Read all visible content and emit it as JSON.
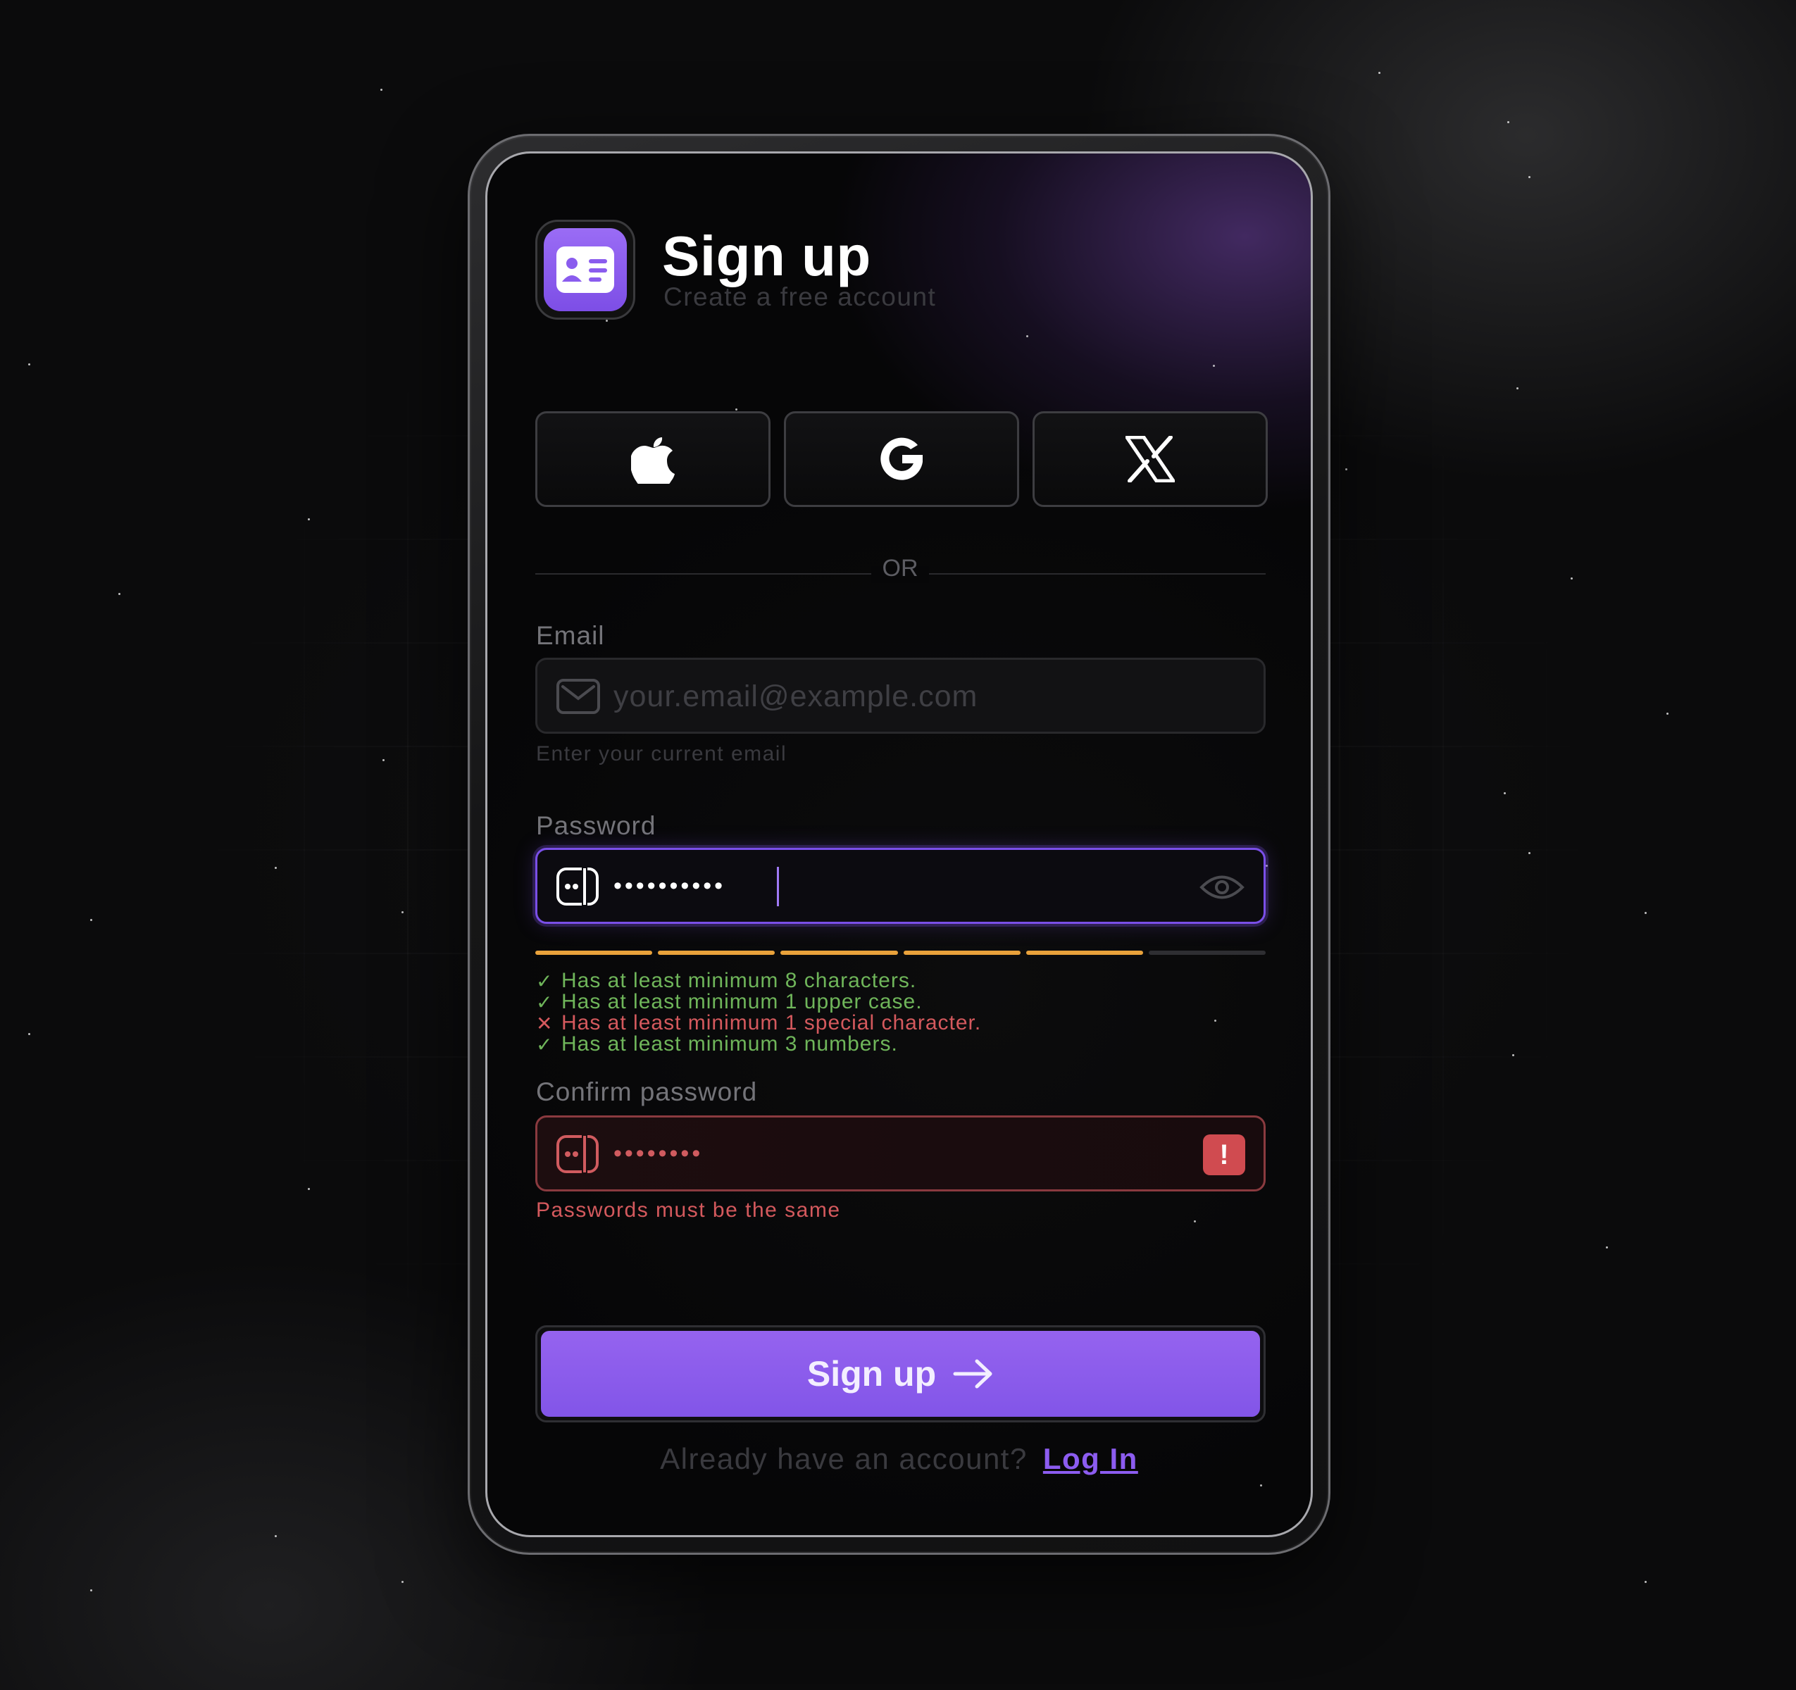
{
  "header": {
    "title": "Sign up",
    "subtitle": "Create a free account",
    "app_icon": "id-card-icon"
  },
  "social": [
    {
      "name": "apple",
      "icon": "apple-icon"
    },
    {
      "name": "google",
      "icon": "google-icon"
    },
    {
      "name": "x",
      "icon": "x-icon"
    }
  ],
  "divider": {
    "label": "OR"
  },
  "email": {
    "label": "Email",
    "placeholder": "your.email@example.com",
    "value": "",
    "hint": "Enter your current email",
    "icon": "mail-icon"
  },
  "password": {
    "label": "Password",
    "masked_value": "••••••••••",
    "icon": "password-icon",
    "toggle_icon": "eye-icon",
    "strength": {
      "filled": 5,
      "total": 6
    },
    "rules": [
      {
        "text": "Has at least minimum 8 characters.",
        "passed": true
      },
      {
        "text": "Has at least minimum 1 upper case.",
        "passed": true
      },
      {
        "text": "Has at least minimum 1 special character.",
        "passed": false
      },
      {
        "text": "Has at least minimum 3 numbers.",
        "passed": true
      }
    ]
  },
  "confirm_password": {
    "label": "Confirm password",
    "masked_value": "••••••••",
    "icon": "password-icon",
    "status_icon": "alert-icon",
    "error": "Passwords must be the same"
  },
  "submit": {
    "label": "Sign up",
    "icon": "arrow-right-icon"
  },
  "footer": {
    "question": "Already have an account?",
    "link": "Log In"
  },
  "colors": {
    "accent": "#8b5cf0",
    "success": "#6fb55a",
    "error": "#d4595d",
    "strength": "#e9a23b"
  }
}
